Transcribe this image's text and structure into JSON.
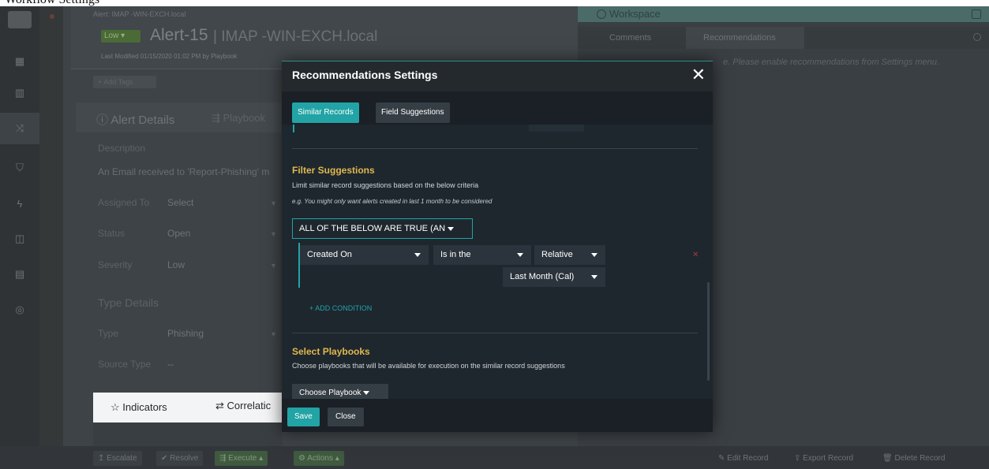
{
  "top_strip": {
    "text": "Workflow Settings"
  },
  "background": {
    "breadcrumb": "Alert: IMAP -WIN-EXCH.local",
    "severity_badge": "Low",
    "record_title": "Alert-15",
    "record_subtitle": "IMAP -WIN-EXCH.local",
    "last_modified": "Last Modified 01/15/2020 01:02 PM by Playbook",
    "add_tags": "+ Add Tags",
    "tab_alert_details": "Alert Details",
    "tab_playbooks": "Playbook",
    "description_label": "Description",
    "description_text": "An Email received to 'Report-Phishing' m",
    "assigned_to_label": "Assigned To",
    "assigned_to_value": "Select",
    "status_label": "Status",
    "status_value": "Open",
    "severity_label": "Severity",
    "severity_value": "Low",
    "type_details_heading": "Type Details",
    "type_label": "Type",
    "type_value": "Phishing",
    "source_type_label": "Source Type",
    "source_type_value": "--",
    "tab_indicators": "Indicators",
    "tab_correlations": "Correlatic"
  },
  "bottom_bar": {
    "escalate": "Escalate",
    "resolve": "Resolve",
    "execute": "Execute",
    "actions": "Actions",
    "edit_record": "Edit Record",
    "export_record": "Export Record",
    "delete_record": "Delete Record"
  },
  "workspace": {
    "title": "Workspace",
    "tab_comments": "Comments",
    "tab_recommendations": "Recommendations",
    "message": "e. Please enable recommendations from Settings menu."
  },
  "modal": {
    "title": "Recommendations Settings",
    "close_glyph": "✕",
    "tab_similar": "Similar Records",
    "tab_field": "Field Suggestions",
    "filter_heading": "Filter Suggestions",
    "filter_sub": "Limit similar record suggestions based on the below criteria",
    "filter_example": "e.g. You might only want alerts created in last 1 month to be considered",
    "logic_select": "ALL OF THE BELOW ARE TRUE (AN",
    "condition": {
      "field": "Created On",
      "operator": "Is in the",
      "mode": "Relative",
      "value": "Last Month (Cal)"
    },
    "delete_glyph": "✕",
    "add_condition": "+ ADD CONDITION",
    "playbooks_heading": "Select Playbooks",
    "playbooks_sub": "Choose playbooks that will be available for execution on the similar record suggestions",
    "choose_playbook": "Choose Playbook",
    "save": "Save",
    "close": "Close"
  },
  "colors": {
    "accent": "#22a3a5",
    "heading": "#e0b84f",
    "modal_bg": "#1e272e",
    "danger": "#a23b3b"
  },
  "icons": {
    "logo": "app-logo",
    "close": "close-icon",
    "caret": "caret-down-icon",
    "star": "star-icon",
    "correlations": "arrows-icon",
    "delete": "trash-icon",
    "edit": "edit-icon",
    "export": "export-icon"
  }
}
